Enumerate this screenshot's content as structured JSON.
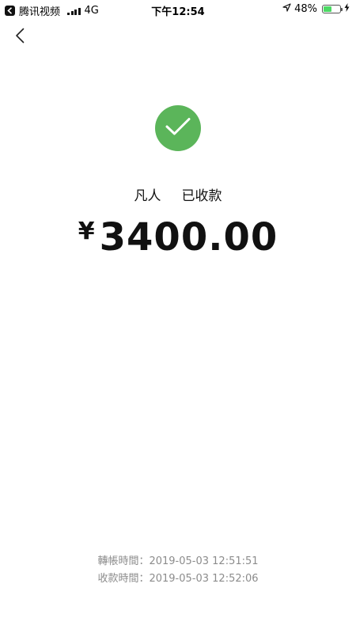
{
  "status_bar": {
    "source_app": "腾讯视频",
    "network": "4G",
    "time": "下午12:54",
    "battery_percent": "48%",
    "battery_level": 0.48
  },
  "nav": {
    "back_icon": "chevron-left-icon"
  },
  "result": {
    "icon": "check-icon",
    "icon_color": "#5bb55a",
    "payee_name": "凡人",
    "payee_suffix": "已收款",
    "currency_symbol": "¥",
    "amount": "3400.00"
  },
  "times": {
    "transfer_label": "轉帳時間",
    "transfer_time": "2019-05-03 12:51:51",
    "receive_label": "收款時間",
    "receive_time": "2019-05-03 12:52:06",
    "separator": "："
  }
}
